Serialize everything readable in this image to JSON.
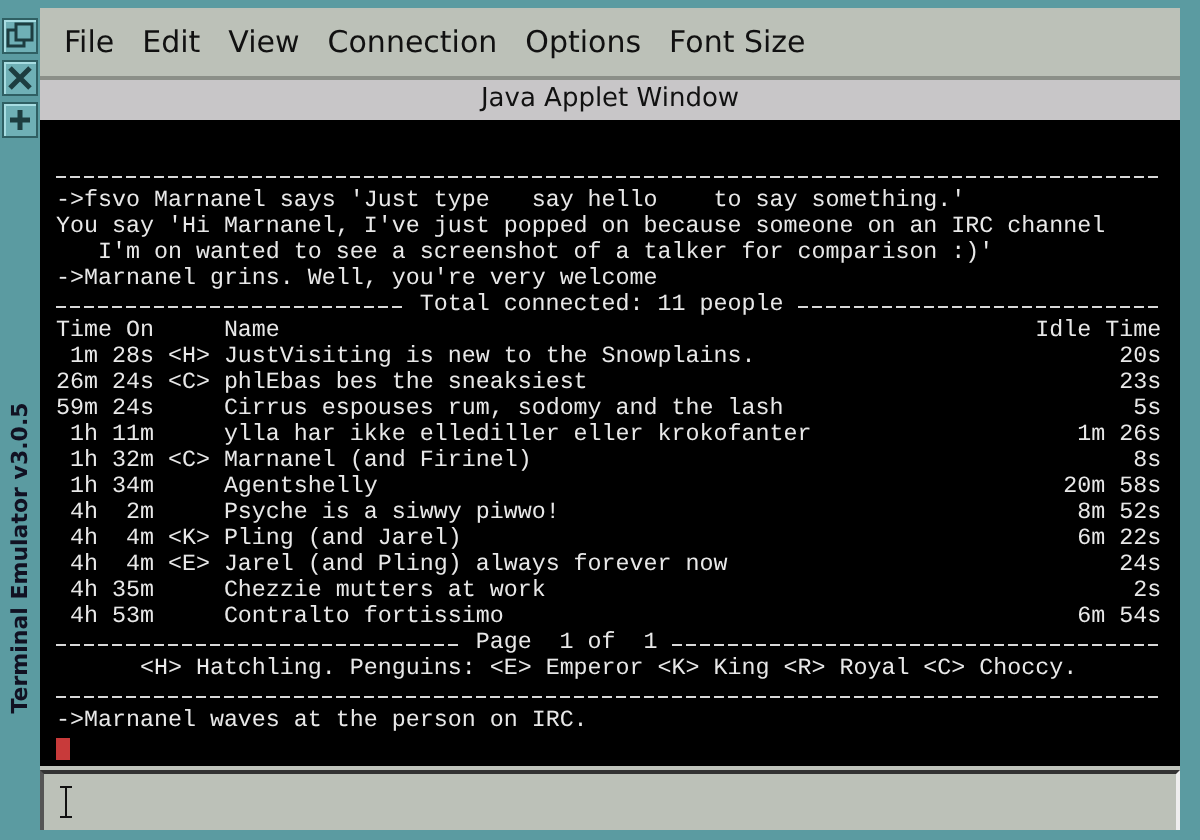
{
  "frame": {
    "title": "Terminal Emulator v3.0.5"
  },
  "menu": [
    "File",
    "Edit",
    "View",
    "Connection",
    "Options",
    "Font Size"
  ],
  "applet_bar": {
    "title": "Java Applet Window"
  },
  "terminal": {
    "messages_before": [
      "->fsvo Marnanel says 'Just type   say hello    to say something.'",
      "You say 'Hi Marnanel, I've just popped on because someone on an IRC channel",
      "   I'm on wanted to see a screenshot of a talker for comparison :)'",
      "->Marnanel grins. Well, you're very welcome"
    ],
    "total_connected": "Total connected: 11 people",
    "header": {
      "time_on": "Time On",
      "name": "Name",
      "idle": "Idle Time"
    },
    "rows": [
      {
        "time": "1m 28s",
        "rank": "<H>",
        "name": "JustVisiting is new to the Snowplains.",
        "idle": "20s"
      },
      {
        "time": "26m 24s",
        "rank": "<C>",
        "name": "phlEbas bes the sneaksiest",
        "idle": "23s"
      },
      {
        "time": "59m 24s",
        "name": "Cirrus espouses rum, sodomy and the lash",
        "idle": "5s"
      },
      {
        "time": "1h 11m",
        "name": "ylla har ikke ellediller eller krokofanter",
        "idle": "1m 26s"
      },
      {
        "time": "1h 32m",
        "rank": "<C>",
        "name": "Marnanel (and Firinel)",
        "idle": "8s"
      },
      {
        "time": "1h 34m",
        "name": "Agentshelly",
        "idle": "20m 58s"
      },
      {
        "time": "4h  2m",
        "name": "Psyche is a siwwy piwwo!",
        "idle": "8m 52s"
      },
      {
        "time": "4h  4m",
        "rank": "<K>",
        "name": "Pling (and Jarel)",
        "idle": "6m 22s"
      },
      {
        "time": "4h  4m",
        "rank": "<E>",
        "name": "Jarel (and Pling) always forever now",
        "idle": "24s"
      },
      {
        "time": "4h 35m",
        "name": "Chezzie mutters at work",
        "idle": "2s"
      },
      {
        "time": "4h 53m",
        "name": "Contralto fortissimo",
        "idle": "6m 54s"
      }
    ],
    "page": "Page  1 of  1",
    "legend": "<H> Hatchling. Penguins: <E> Emperor <K> King <R> Royal <C> Choccy.",
    "messages_after": [
      "->Marnanel waves at the person on IRC."
    ]
  }
}
